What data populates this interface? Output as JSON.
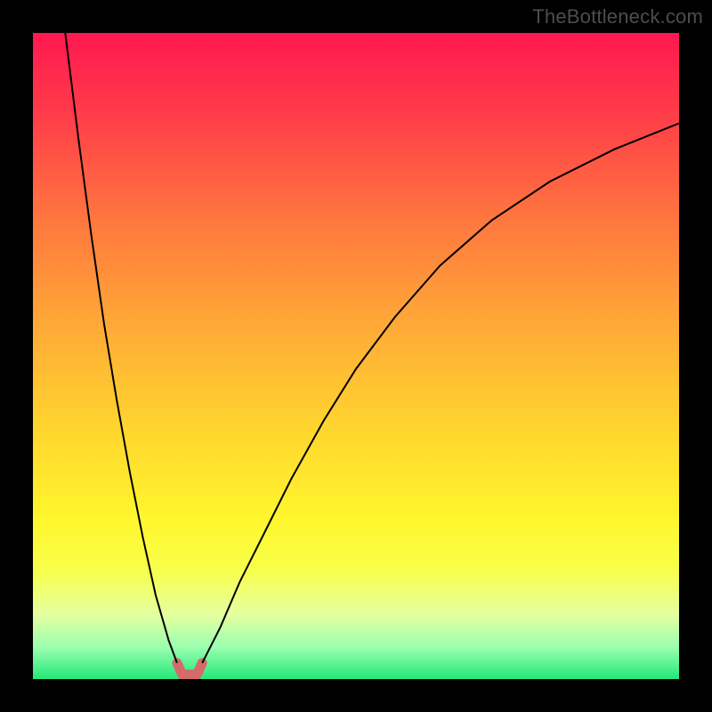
{
  "watermark": "TheBottleneck.com",
  "chart_data": {
    "type": "line",
    "title": "",
    "xlabel": "",
    "ylabel": "",
    "xlim": [
      0,
      100
    ],
    "ylim": [
      0,
      100
    ],
    "grid": false,
    "legend": false,
    "background": "red-yellow-green vertical gradient",
    "series": [
      {
        "name": "left-branch",
        "color": "#000000",
        "x": [
          5,
          7,
          9,
          11,
          13,
          15,
          17,
          19,
          21,
          22.3
        ],
        "values": [
          100,
          84,
          69,
          55,
          43,
          32,
          22,
          13,
          6,
          2.5
        ]
      },
      {
        "name": "right-branch",
        "color": "#000000",
        "x": [
          26.2,
          29,
          32,
          36,
          40,
          45,
          50,
          56,
          63,
          71,
          80,
          90,
          100
        ],
        "values": [
          2.5,
          8,
          15,
          23,
          31,
          40,
          48,
          56,
          64,
          71,
          77,
          82,
          86
        ]
      },
      {
        "name": "valley-marker",
        "color": "#e06666",
        "stroke_width_px": 11,
        "x": [
          22.3,
          23.1,
          25.4,
          26.2
        ],
        "values": [
          2.5,
          0.7,
          0.7,
          2.5
        ]
      }
    ],
    "valley_x": 24.2,
    "note": "Values are read off the plot relative to the inner 726x726 drawing area; x and y are percentages of that area (0 = left/bottom, 100 = right/top)."
  }
}
